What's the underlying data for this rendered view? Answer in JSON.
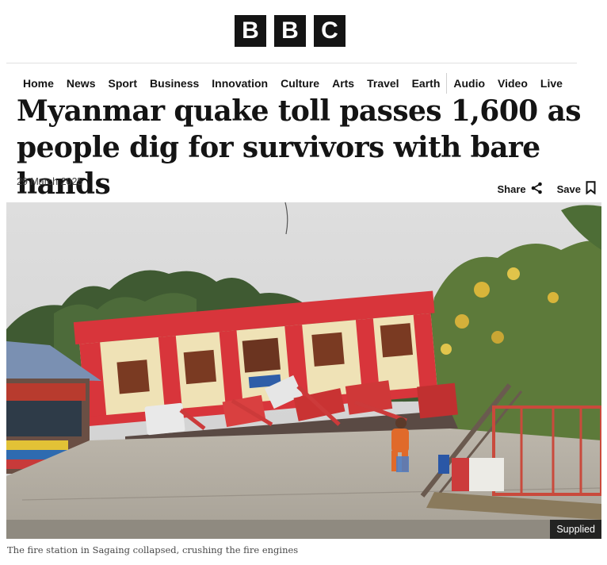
{
  "brand": {
    "letters": [
      "B",
      "B",
      "C"
    ]
  },
  "nav": {
    "items": [
      "Home",
      "News",
      "Sport",
      "Business",
      "Innovation",
      "Culture",
      "Arts",
      "Travel",
      "Earth"
    ],
    "items_after_divider": [
      "Audio",
      "Video",
      "Live"
    ]
  },
  "article": {
    "headline": "Myanmar quake toll passes 1,600 as people dig for survivors with bare hands",
    "date": "29 March 2025",
    "share_label": "Share",
    "save_label": "Save"
  },
  "image": {
    "credit": "Supplied",
    "caption": "The fire station in Sagaing collapsed, crushing the fire engines"
  },
  "icons": {
    "share": "share-icon",
    "save": "bookmark-icon"
  },
  "colors": {
    "brand_black": "#141414",
    "building_red": "#d8353b",
    "wall_cream": "#efe2b6"
  }
}
